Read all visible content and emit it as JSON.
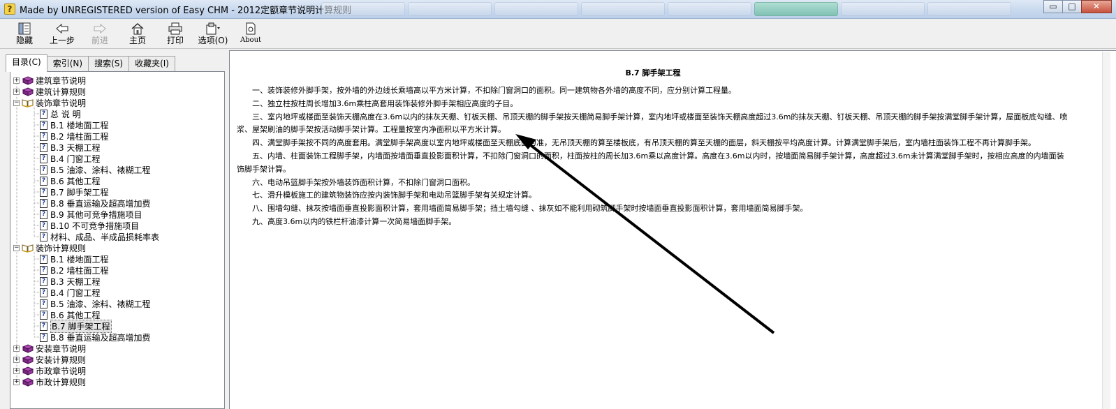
{
  "window": {
    "title": "Made by UNREGISTERED version of Easy CHM - 2012定额章节说明计算规则",
    "controls": {
      "minimize": "▭",
      "maximize": "□",
      "close": "✕"
    }
  },
  "toolbar": {
    "buttons": [
      {
        "id": "hide",
        "label": "隐藏",
        "icon": "hide-panel-icon"
      },
      {
        "id": "back",
        "label": "上一步",
        "icon": "back-arrow-icon"
      },
      {
        "id": "forward",
        "label": "前进",
        "icon": "forward-arrow-icon",
        "disabled": true
      },
      {
        "id": "home",
        "label": "主页",
        "icon": "home-icon"
      },
      {
        "id": "print",
        "label": "打印",
        "icon": "printer-icon"
      },
      {
        "id": "options",
        "label": "选项(O)",
        "icon": "options-icon"
      },
      {
        "id": "about",
        "label": "About",
        "icon": "about-document-icon"
      }
    ]
  },
  "nav_tabs": [
    "目录(C)",
    "索引(N)",
    "搜索(S)",
    "收藏夹(I)"
  ],
  "tree": [
    {
      "label": "建筑章节说明",
      "type": "book",
      "expand": "+",
      "level": 0
    },
    {
      "label": "建筑计算规则",
      "type": "book",
      "expand": "+",
      "level": 0
    },
    {
      "label": "装饰章节说明",
      "type": "open-book",
      "expand": "−",
      "level": 0
    },
    {
      "label": "总 说 明",
      "type": "page",
      "level": 1
    },
    {
      "label": "B.1 楼地面工程",
      "type": "page",
      "level": 1
    },
    {
      "label": "B.2 墙柱面工程",
      "type": "page",
      "level": 1
    },
    {
      "label": "B.3 天棚工程",
      "type": "page",
      "level": 1
    },
    {
      "label": "B.4 门窗工程",
      "type": "page",
      "level": 1
    },
    {
      "label": "B.5 油漆、涂料、裱糊工程",
      "type": "page",
      "level": 1
    },
    {
      "label": "B.6 其他工程",
      "type": "page",
      "level": 1
    },
    {
      "label": "B.7 脚手架工程",
      "type": "page",
      "level": 1
    },
    {
      "label": "B.8 垂直运输及超高增加费",
      "type": "page",
      "level": 1
    },
    {
      "label": "B.9 其他可竞争措施项目",
      "type": "page",
      "level": 1
    },
    {
      "label": "B.10 不可竞争措施项目",
      "type": "page",
      "level": 1
    },
    {
      "label": "材料、成品、半成品损耗率表",
      "type": "page",
      "level": 1
    },
    {
      "label": "装饰计算规则",
      "type": "open-book",
      "expand": "−",
      "level": 0
    },
    {
      "label": "B.1 楼地面工程",
      "type": "page",
      "level": 1
    },
    {
      "label": "B.2 墙柱面工程",
      "type": "page",
      "level": 1
    },
    {
      "label": "B.3 天棚工程",
      "type": "page",
      "level": 1
    },
    {
      "label": "B.4 门窗工程",
      "type": "page",
      "level": 1
    },
    {
      "label": "B.5 油漆、涂料、裱糊工程",
      "type": "page",
      "level": 1
    },
    {
      "label": "B.6 其他工程",
      "type": "page",
      "level": 1
    },
    {
      "label": "B.7 脚手架工程",
      "type": "page",
      "level": 1,
      "selected": true
    },
    {
      "label": "B.8 垂直运输及超高增加费",
      "type": "page",
      "level": 1
    },
    {
      "label": "安装章节说明",
      "type": "book",
      "expand": "+",
      "level": 0
    },
    {
      "label": "安装计算规则",
      "type": "book",
      "expand": "+",
      "level": 0
    },
    {
      "label": "市政章节说明",
      "type": "book",
      "expand": "+",
      "level": 0
    },
    {
      "label": "市政计算规则",
      "type": "book",
      "expand": "+",
      "level": 0
    }
  ],
  "document": {
    "title": "B.7 脚手架工程",
    "paragraphs": [
      "一、装饰装修外脚手架，按外墙的外边线长乘墙高以平方米计算，不扣除门窗洞口的面积。同一建筑物各外墙的高度不同，应分别计算工程量。",
      "二、独立柱按柱周长增加3.6m乘柱高套用装饰装修外脚手架相应高度的子目。",
      "三、室内地坪或楼面至装饰天棚高度在3.6m以内的抹灰天棚、钉板天棚、吊顶天棚的脚手架按天棚简易脚手架计算，室内地坪或楼面至装饰天棚高度超过3.6m的抹灰天棚、钉板天棚、吊顶天棚的脚手架按满堂脚手架计算，屋面板底勾缝、喷浆、屋架刷油的脚手架按活动脚手架计算。工程量按室内净面积以平方米计算。",
      "四、满堂脚手架按不同的高度套用。满堂脚手架高度以室内地坪或楼面至天棚底面为准，无吊顶天棚的算至楼板底，有吊顶天棚的算至天棚的面层，斜天棚按平均高度计算。计算满堂脚手架后，室内墙柱面装饰工程不再计算脚手架。",
      "五、内墙、柱面装饰工程脚手架，内墙面按墙面垂直投影面积计算，不扣除门窗洞口的面积，柱面按柱的周长加3.6m乘以高度计算。高度在3.6m以内时，按墙面简易脚手架计算，高度超过3.6m未计算满堂脚手架时，按相应高度的内墙面装饰脚手架计算。",
      "六、电动吊篮脚手架按外墙装饰面积计算，不扣除门窗洞口面积。",
      "七、滑升模板施工的建筑物装饰应按内装饰脚手架和电动吊篮脚手架有关规定计算。",
      "八、围墙勾缝、抹灰按墙面垂直投影面积计算，套用墙面简易脚手架；挡土墙勾缝 、抹灰如不能利用砌筑脚手架时按墙面垂直投影面积计算，套用墙面简易脚手架。",
      "九、高度3.6m以内的铁栏杆油漆计算一次简易墙面脚手架。"
    ]
  },
  "colors": {
    "book": "#8a2a8e",
    "title_bar": "#c9d9ee",
    "accent": "#1a3fa0"
  }
}
